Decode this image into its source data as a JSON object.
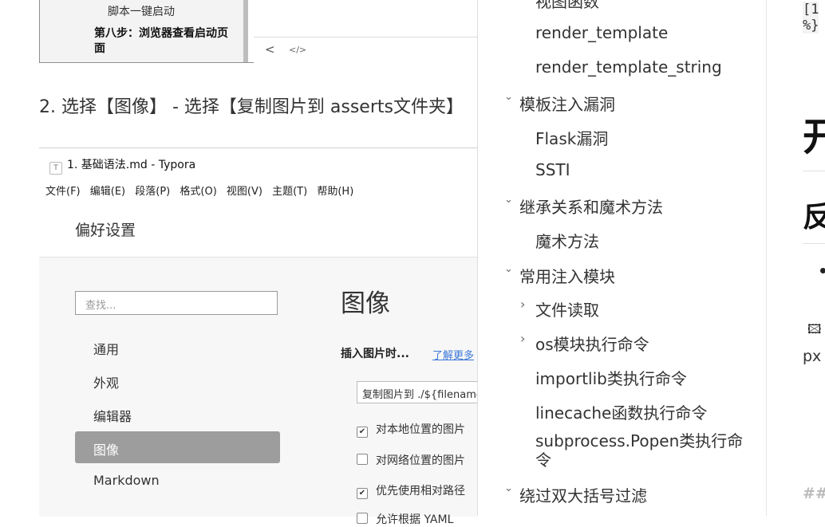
{
  "top_shot": {
    "step7_text": "脚本一键启动",
    "step8_text": "第八步：浏览器查看启动页面",
    "prev_glyph": "<",
    "source_glyph": "</>"
  },
  "paragraph": {
    "text": "2. 选择【图像】 - 选择【复制图片到 asserts文件夹】"
  },
  "typora": {
    "window_title": "1. 基础语法.md - Typora",
    "title_icon": "T",
    "menu": [
      "文件(F)",
      "编辑(E)",
      "段落(P)",
      "格式(O)",
      "视图(V)",
      "主题(T)",
      "帮助(H)"
    ],
    "prefs_title": "偏好设置",
    "search_placeholder": "查找...",
    "nav": [
      "通用",
      "外观",
      "编辑器",
      "图像",
      "Markdown"
    ],
    "active_nav": "图像",
    "section_title": "图像",
    "insert_label": "插入图片时...",
    "learn_more": "了解更多",
    "select_value": "复制图片到 ./${filename}",
    "checks": [
      {
        "label": "对本地位置的图片",
        "checked": true
      },
      {
        "label": "对网络位置的图片",
        "checked": false
      },
      {
        "label": "优先使用相对路径",
        "checked": true
      },
      {
        "label": "允许根据 YAML",
        "checked": false
      }
    ]
  },
  "toc": {
    "items": [
      {
        "label": "视图函数",
        "level": 2,
        "chevron": ""
      },
      {
        "label": "render_template",
        "level": 2,
        "chevron": ""
      },
      {
        "label": "render_template_string",
        "level": 2,
        "chevron": ""
      },
      {
        "label": "模板注入漏洞",
        "level": 1,
        "chevron": "down"
      },
      {
        "label": "Flask漏洞",
        "level": 2,
        "chevron": ""
      },
      {
        "label": "SSTI",
        "level": 2,
        "chevron": ""
      },
      {
        "label": "继承关系和魔术方法",
        "level": 1,
        "chevron": "down"
      },
      {
        "label": "魔术方法",
        "level": 2,
        "chevron": ""
      },
      {
        "label": "常用注入模块",
        "level": 1,
        "chevron": "down"
      },
      {
        "label": "文件读取",
        "level": 2,
        "chevron": "right"
      },
      {
        "label": "os模块执行命令",
        "level": 2,
        "chevron": "right"
      },
      {
        "label": "importlib类执行命令",
        "level": 2,
        "chevron": ""
      },
      {
        "label": "linecache函数执行命令",
        "level": 2,
        "chevron": ""
      },
      {
        "label": "subprocess.Popen类执行命令",
        "level": 2,
        "chevron": ""
      },
      {
        "label": "绕过双大括号过滤",
        "level": 1,
        "chevron": "down"
      }
    ],
    "chevron_down": "⌄",
    "chevron_right": "›"
  },
  "preview": {
    "code_line1": "[1",
    "code_line2": "%}",
    "big_heading": "开",
    "med_heading": "反",
    "img_glyph": "🖾",
    "px_text": "px",
    "hash_text": "##"
  },
  "colors": {
    "active_nav_bg": "#9d9d9d",
    "link": "#3b78d8"
  }
}
